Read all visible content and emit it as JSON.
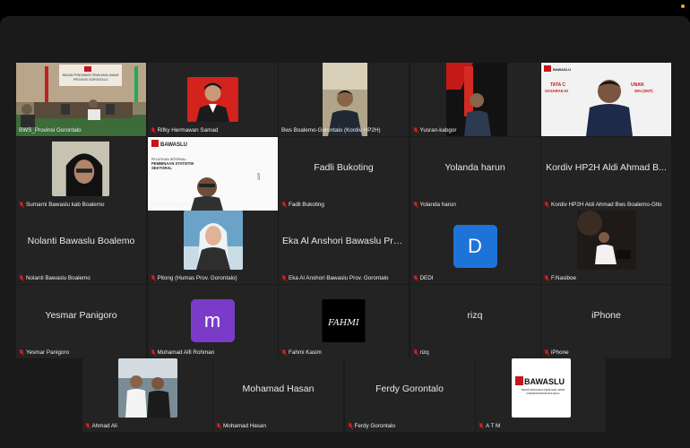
{
  "participants": [
    {
      "name": "BWS_Provinsi Gorontalo",
      "display": "",
      "kind": "video",
      "muted": false,
      "active": true,
      "video_text": [
        "BADAN PENGAWAS PEMILIHAN UMUM",
        "PROVINSI GORONTALO"
      ]
    },
    {
      "name": "Rifky Hermawan Samad",
      "display": "",
      "kind": "photo",
      "muted": true
    },
    {
      "name": "Bws Boalemo-Gorontalo (Kordiv HP2H)",
      "display": "",
      "kind": "video",
      "muted": false
    },
    {
      "name": "Yusran-kabgor",
      "display": "",
      "kind": "video",
      "muted": true
    },
    {
      "name": "Rahmat Djakaria",
      "display": "",
      "kind": "video",
      "muted": false,
      "video_text": [
        "BAWASLU",
        "TATA C",
        "UNAN",
        "SASARAN KI",
        "WAI (SKP)"
      ]
    },
    {
      "name": "Sumarni Bawaslu kab Boalemo",
      "display": "",
      "kind": "video",
      "muted": true
    },
    {
      "name": "Iswan bwslugtlo",
      "display": "",
      "kind": "video",
      "muted": false,
      "video_text": [
        "BAWASLU",
        "PELATIHAN INTERNAL:",
        "PEMBINAAN STATISTIK",
        "SEKTORAL",
        "2025"
      ]
    },
    {
      "name": "Fadli Bukoting",
      "display": "Fadli Bukoting",
      "kind": "name",
      "muted": true
    },
    {
      "name": "Yolanda harun",
      "display": "Yolanda harun",
      "kind": "name",
      "muted": true
    },
    {
      "name": "Kordiv HP2H Aldi Ahmad Bws Boalemo-Gtlo",
      "display": "Kordiv HP2H Aldi Ahmad B...",
      "kind": "name",
      "muted": true
    },
    {
      "name": "Nolanti Bawaslu Boalemo",
      "display": "Nolanti Bawaslu Boalemo",
      "kind": "name",
      "muted": true
    },
    {
      "name": "Pitong (Humas Prov. Gorontalo)",
      "display": "",
      "kind": "photo",
      "muted": true
    },
    {
      "name": "Eka Al Anshori Bawaslu Prov. Gorontalo",
      "display": "Eka Al Anshori Bawaslu Prov...",
      "kind": "name",
      "muted": true
    },
    {
      "name": "DEDI",
      "display": "",
      "kind": "avatar",
      "letter": "D",
      "muted": true
    },
    {
      "name": "F.Nasiboe",
      "display": "",
      "kind": "photo",
      "muted": true
    },
    {
      "name": "Yesmar Panigoro",
      "display": "Yesmar Panigoro",
      "kind": "name",
      "muted": true
    },
    {
      "name": "Muhamad Alfi Rohman",
      "display": "",
      "kind": "avatar",
      "letter": "m",
      "muted": true
    },
    {
      "name": "Fahmi Kasim",
      "display": "",
      "kind": "photo",
      "muted": true,
      "photo_text": "FAHMI"
    },
    {
      "name": "rizq",
      "display": "rizq",
      "kind": "name",
      "muted": true
    },
    {
      "name": "iPhone",
      "display": "iPhone",
      "kind": "name",
      "muted": true
    },
    {
      "name": "Ahmad Ali",
      "display": "",
      "kind": "photo",
      "muted": true
    },
    {
      "name": "Mohamad Hasan",
      "display": "Mohamad Hasan",
      "kind": "name",
      "muted": true
    },
    {
      "name": "Ferdy Gorontalo",
      "display": "Ferdy Gorontalo",
      "kind": "name",
      "muted": true
    },
    {
      "name": "A T M",
      "display": "",
      "kind": "photo",
      "muted": true,
      "photo_text": [
        "BAWASLU",
        "BADAN PENGAWAS PEMILIHAN UMUM",
        "KABUPATEN BONE BOLANGO"
      ]
    }
  ],
  "colors": {
    "muted_mic": "#e02020",
    "active_border": "#2ecc40",
    "avatar_d": "#1e73d8",
    "avatar_m": "#7a3cc8",
    "bawaslu_red": "#c4161c"
  }
}
